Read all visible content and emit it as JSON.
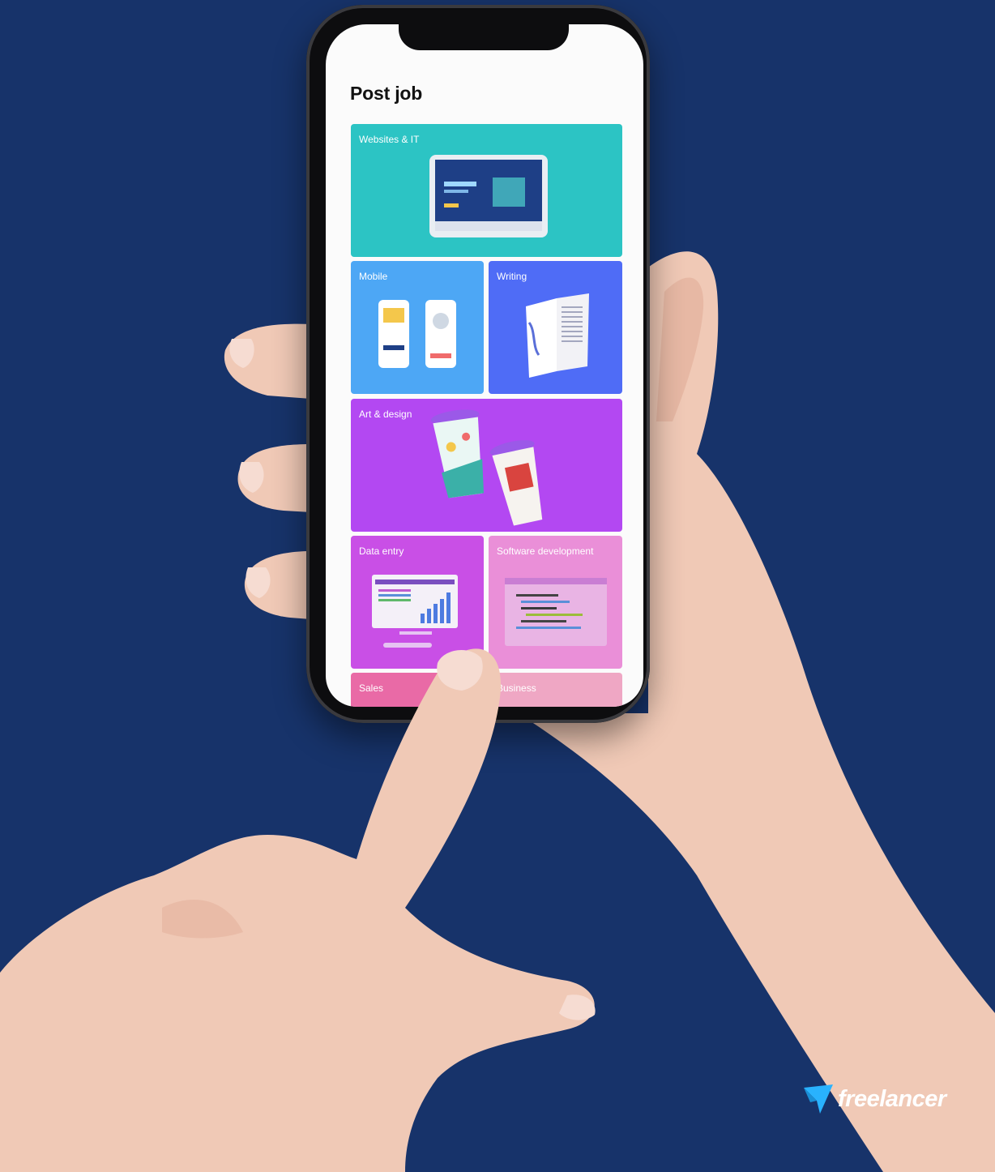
{
  "screen": {
    "title": "Post job",
    "categories": [
      {
        "label": "Websites & IT",
        "color": "#2cc4c4"
      },
      {
        "label": "Mobile",
        "color": "#4da7f5"
      },
      {
        "label": "Writing",
        "color": "#4f6cf6"
      },
      {
        "label": "Art & design",
        "color": "#b348f2"
      },
      {
        "label": "Data entry",
        "color": "#c94fe6"
      },
      {
        "label": "Software development",
        "color": "#ea8fd8"
      },
      {
        "label": "Sales",
        "color": "#e96aa6"
      },
      {
        "label": "Business",
        "color": "#efa7c4"
      }
    ]
  },
  "brand": {
    "name": "freelancer",
    "background": "#17336a",
    "icon": "freelancer-bird-logo-icon"
  }
}
